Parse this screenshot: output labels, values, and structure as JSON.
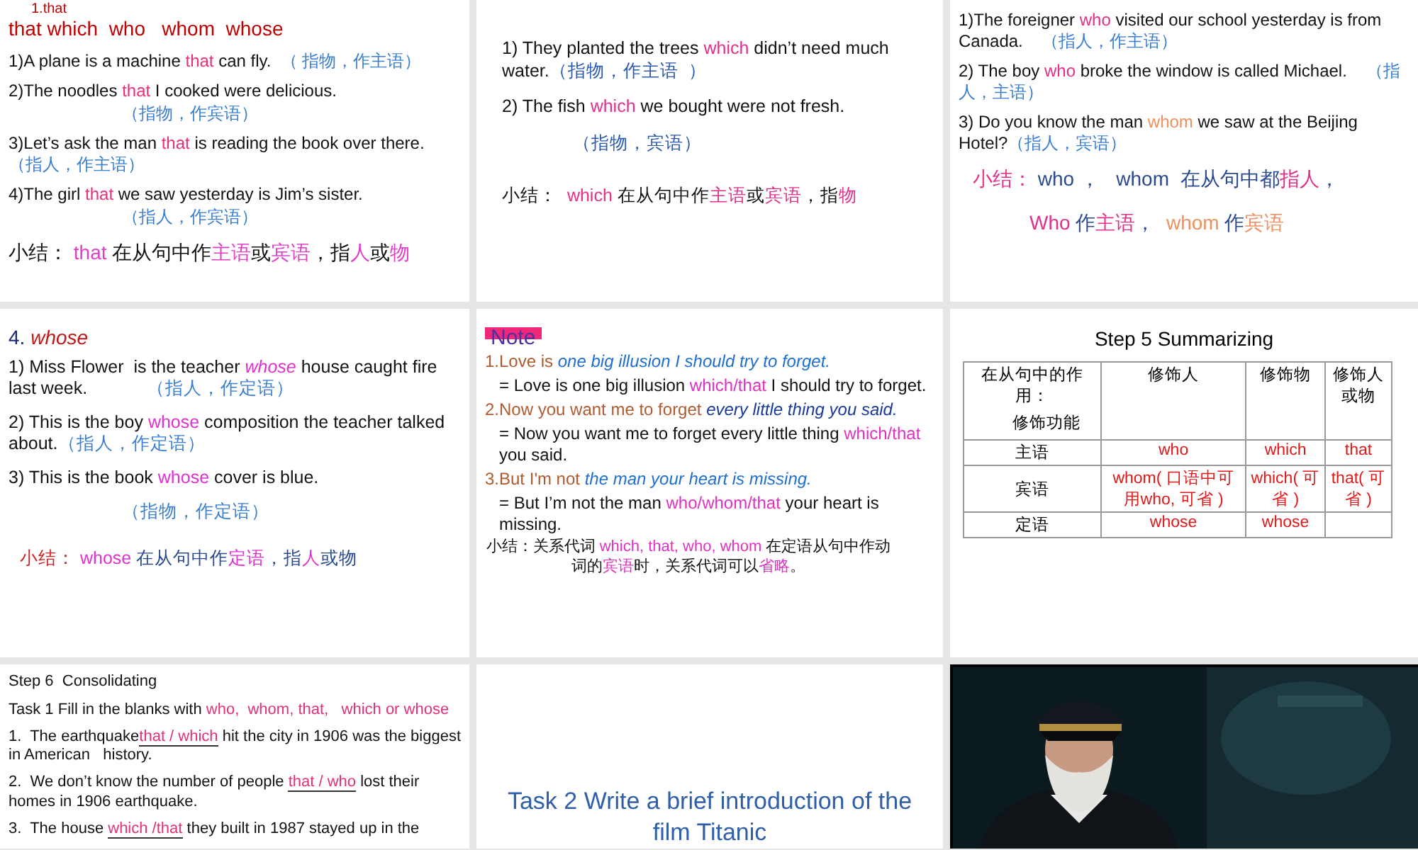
{
  "slides": [
    {
      "kind": "text",
      "overlay_label": "1.that",
      "lines": [
        {
          "kind": "heading",
          "parts": [
            {
              "text": "that which  who   whom  whose",
              "color": "#c00000"
            }
          ]
        },
        {
          "kind": "sentence",
          "parts": [
            {
              "text": "1)A plane is a machine "
            },
            {
              "text": "that",
              "color": "#e8307a"
            },
            {
              "text": " can fly.  "
            },
            {
              "text": "（ 指物，作主语）",
              "color": "#3a7fd0"
            }
          ]
        },
        {
          "kind": "sentence",
          "parts": [
            {
              "text": "2)The noodles "
            },
            {
              "text": "that",
              "color": "#e8307a"
            },
            {
              "text": " I cooked were delicious."
            }
          ]
        },
        {
          "kind": "note",
          "parts": [
            {
              "text": "（指物，作宾语）",
              "color": "#3a7fd0"
            }
          ]
        },
        {
          "kind": "sentence",
          "parts": [
            {
              "text": "3)Let’s ask the man "
            },
            {
              "text": "that",
              "color": "#e8307a"
            },
            {
              "text": " is reading the book over there.            "
            },
            {
              "text": "（指人，作主语）",
              "color": "#3a7fd0"
            }
          ]
        },
        {
          "kind": "sentence",
          "parts": [
            {
              "text": "4)The girl "
            },
            {
              "text": "that",
              "color": "#e8307a"
            },
            {
              "text": " we saw yesterday is Jim’s sister."
            }
          ]
        },
        {
          "kind": "note",
          "parts": [
            {
              "text": "（指人，作宾语）",
              "color": "#3a7fd0"
            }
          ]
        },
        {
          "kind": "summary",
          "parts": [
            {
              "text": "小结： "
            },
            {
              "text": "that",
              "color": "#e040c8"
            },
            {
              "text": " 在从句中作"
            },
            {
              "text": "主语",
              "color": "#e040c8"
            },
            {
              "text": "或"
            },
            {
              "text": "宾语",
              "color": "#e040c8"
            },
            {
              "text": "，指"
            },
            {
              "text": "人",
              "color": "#e040c8"
            },
            {
              "text": "或"
            },
            {
              "text": "物",
              "color": "#e040c8"
            }
          ]
        }
      ]
    },
    {
      "kind": "text",
      "lines": [
        {
          "kind": "sentence",
          "parts": [
            {
              "text": "1) They planted the trees "
            },
            {
              "text": "which",
              "color": "#e0308a"
            },
            {
              "text": " didn’t need much water."
            },
            {
              "text": "（指物，作主语  ）",
              "color": "#2a5ab0"
            }
          ]
        },
        {
          "kind": "sentence",
          "parts": [
            {
              "text": "2) The fish "
            },
            {
              "text": "which",
              "color": "#e0308a"
            },
            {
              "text": " we bought were not fresh."
            }
          ]
        },
        {
          "kind": "note",
          "parts": [
            {
              "text": "（指物，宾语）",
              "color": "#2a5ab0"
            }
          ]
        },
        {
          "kind": "summary",
          "parts": [
            {
              "text": "小结：  "
            },
            {
              "text": "which",
              "color": "#e0308a"
            },
            {
              "text": " 在从句中作"
            },
            {
              "text": "主语",
              "color": "#e0308a"
            },
            {
              "text": "或"
            },
            {
              "text": "宾语",
              "color": "#e0308a"
            },
            {
              "text": "，指"
            },
            {
              "text": "物",
              "color": "#e0308a"
            }
          ]
        }
      ]
    },
    {
      "kind": "text",
      "lines": [
        {
          "kind": "sentence",
          "parts": [
            {
              "text": "1)The foreigner "
            },
            {
              "text": "who",
              "color": "#e0308a"
            },
            {
              "text": " visited our school yesterday is from Canada.    "
            },
            {
              "text": "（指人，作主语）",
              "color": "#3a7fd0"
            }
          ]
        },
        {
          "kind": "sentence",
          "parts": [
            {
              "text": "2) The boy "
            },
            {
              "text": "who",
              "color": "#e0308a"
            },
            {
              "text": " broke the window is called Michael.    "
            },
            {
              "text": "（指人，主语）",
              "color": "#3a7fd0"
            }
          ]
        },
        {
          "kind": "sentence",
          "parts": [
            {
              "text": "3) Do you know the man "
            },
            {
              "text": "whom",
              "color": "#f09060"
            },
            {
              "text": " we saw at the Beijing Hotel?"
            },
            {
              "text": "（指人，宾语）",
              "color": "#3a7fd0"
            }
          ]
        },
        {
          "kind": "summary",
          "parts": [
            {
              "text": "小结：",
              "color": "#e0308a"
            },
            {
              "text": " who ，   whom  在从句中都",
              "color": "#2a4a90"
            },
            {
              "text": "指人",
              "color": "#e0308a"
            },
            {
              "text": "，",
              "color": "#2a4a90"
            }
          ]
        },
        {
          "kind": "summary",
          "parts": [
            {
              "text": "Who",
              "color": "#e0308a"
            },
            {
              "text": " 作",
              "color": "#2a4a90"
            },
            {
              "text": "主语",
              "color": "#e0308a"
            },
            {
              "text": "，  ",
              "color": "#2a4a90"
            },
            {
              "text": "whom",
              "color": "#f09060"
            },
            {
              "text": " 作",
              "color": "#2a4a90"
            },
            {
              "text": "宾语",
              "color": "#f09060"
            }
          ]
        }
      ]
    },
    {
      "kind": "text",
      "lines": [
        {
          "kind": "heading",
          "parts": [
            {
              "text": "4. ",
              "color": "#1a2a70"
            },
            {
              "text": "whose",
              "color": "#c01818",
              "italic": true
            }
          ]
        },
        {
          "kind": "sentence",
          "parts": [
            {
              "text": "1) Miss Flower  is the teacher "
            },
            {
              "text": "whose",
              "color": "#e030d0",
              "italic": true
            },
            {
              "text": " house caught fire last week.            "
            },
            {
              "text": "（指人，作定语）",
              "color": "#3a7fd0"
            }
          ]
        },
        {
          "kind": "sentence",
          "parts": [
            {
              "text": "2) This is the boy "
            },
            {
              "text": "whose",
              "color": "#e030d0"
            },
            {
              "text": " composition the teacher talked about."
            },
            {
              "text": "（指人，作定语）",
              "color": "#3a7fd0"
            }
          ]
        },
        {
          "kind": "sentence",
          "parts": [
            {
              "text": "3) This is the book "
            },
            {
              "text": "whose",
              "color": "#e030d0"
            },
            {
              "text": " cover is blue."
            }
          ]
        },
        {
          "kind": "note",
          "parts": [
            {
              "text": "（指物，作定语）",
              "color": "#3a7fd0"
            }
          ]
        },
        {
          "kind": "summary",
          "parts": [
            {
              "text": "小结： ",
              "color": "#d02020"
            },
            {
              "text": "whose",
              "color": "#e030d0"
            },
            {
              "text": " 在从句中作",
              "color": "#2a4a90"
            },
            {
              "text": "定语",
              "color": "#e030d0"
            },
            {
              "text": "，指",
              "color": "#2a4a90"
            },
            {
              "text": "人",
              "color": "#e030d0"
            },
            {
              "text": "或物",
              "color": "#2a4a90"
            }
          ]
        }
      ]
    },
    {
      "kind": "text",
      "lines": [
        {
          "kind": "tag",
          "parts": [
            {
              "text": "Note"
            }
          ]
        },
        {
          "kind": "sentence",
          "parts": [
            {
              "text": "1.Love is ",
              "color": "#b05a30"
            },
            {
              "text": "one big illusion I should try to forget.",
              "color": "#2070d0",
              "italic": true
            }
          ]
        },
        {
          "kind": "answer",
          "parts": [
            {
              "text": "= Love is one big illusion "
            },
            {
              "text": "which/that",
              "color": "#e030c0"
            },
            {
              "text": " I should try to forget."
            }
          ]
        },
        {
          "kind": "sentence",
          "parts": [
            {
              "text": "2.Now you want me to forget ",
              "color": "#b05a30"
            },
            {
              "text": "every little thing you said.",
              "color": "#1a3a9a",
              "italic": true
            }
          ]
        },
        {
          "kind": "answer",
          "parts": [
            {
              "text": "= Now you want me to forget every little thing "
            },
            {
              "text": "which/that",
              "color": "#e030c0"
            },
            {
              "text": " you said."
            }
          ]
        },
        {
          "kind": "sentence",
          "parts": [
            {
              "text": "3.But I'm not ",
              "color": "#b05a30"
            },
            {
              "text": "the man your heart is missing.",
              "color": "#2070d0",
              "italic": true
            }
          ]
        },
        {
          "kind": "answer",
          "parts": [
            {
              "text": "= But I’m not the man "
            },
            {
              "text": "who/whom/that",
              "color": "#e030c0"
            },
            {
              "text": " your heart is missing."
            }
          ]
        },
        {
          "kind": "footnote",
          "parts": [
            {
              "text": "小结：关系代词 "
            },
            {
              "text": "which, that, who, whom",
              "color": "#e030c0"
            },
            {
              "text": " 在定语从句中作动词的"
            },
            {
              "text": "宾语",
              "color": "#e030c0"
            },
            {
              "text": "时，关系代词可以"
            },
            {
              "text": "省略",
              "color": "#e030c0"
            },
            {
              "text": "。"
            }
          ]
        }
      ]
    },
    {
      "kind": "table",
      "title": "Step 5 Summarizing",
      "header": [
        "在从句中的作用：",
        "修饰人",
        "修饰物",
        "修饰人或物"
      ],
      "header_sub": "修饰功能",
      "rows": [
        {
          "label": "主语",
          "cells": [
            "who",
            "which",
            "that"
          ]
        },
        {
          "label": "宾语",
          "cells": [
            "whom( 口语中可用who, 可省 )",
            "which( 可省 )",
            "that( 可省 )"
          ]
        },
        {
          "label": "定语",
          "cells": [
            "whose",
            "whose"
          ]
        }
      ]
    },
    {
      "kind": "text",
      "lines": [
        {
          "kind": "heading",
          "parts": [
            {
              "text": "Step 6  Consolidating"
            }
          ]
        },
        {
          "kind": "sentence",
          "parts": [
            {
              "text": "Task 1 Fill in the blanks with "
            },
            {
              "text": "who,  whom, that,   which or whose",
              "color": "#e0307a"
            }
          ]
        },
        {
          "kind": "sentence",
          "parts": [
            {
              "text": "1.  The earthquake"
            },
            {
              "text": "that / which",
              "color": "#e0307a",
              "blank": true
            },
            {
              "text": " hit the city in 1906 was the biggest in American   history."
            }
          ]
        },
        {
          "kind": "sentence",
          "parts": [
            {
              "text": "2.  We don’t know the number of people "
            },
            {
              "text": "that / who",
              "color": "#e0307a",
              "blank": true
            },
            {
              "text": " lost their homes in 1906 earthquake."
            }
          ]
        },
        {
          "kind": "sentence",
          "parts": [
            {
              "text": "3.  The house "
            },
            {
              "text": "which /that",
              "color": "#e0307a",
              "blank": true
            },
            {
              "text": " they built in 1987 stayed up in the"
            }
          ]
        }
      ]
    },
    {
      "kind": "text",
      "lines": [
        {
          "kind": "title",
          "parts": [
            {
              "text": "Task 2 Write a brief introduction of the film Titanic",
              "color": "#2f5fa8"
            }
          ]
        }
      ]
    },
    {
      "kind": "picture"
    }
  ]
}
